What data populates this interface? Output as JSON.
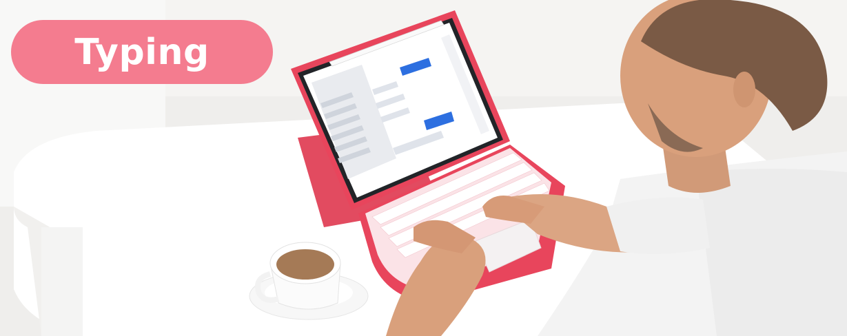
{
  "badge": {
    "label": "Typing"
  },
  "colors": {
    "badge": "#f47c8f",
    "case": "#e8455c",
    "keys": "#fbe7ea",
    "table": "#ffffff",
    "shirt": "#f2f2f2",
    "skin": "#d9a07c",
    "hair": "#7a5a45",
    "coffee": "#a57a56"
  },
  "objects": [
    "tablet-keyboard-case",
    "coffee-cup",
    "person-typing",
    "white-table"
  ]
}
